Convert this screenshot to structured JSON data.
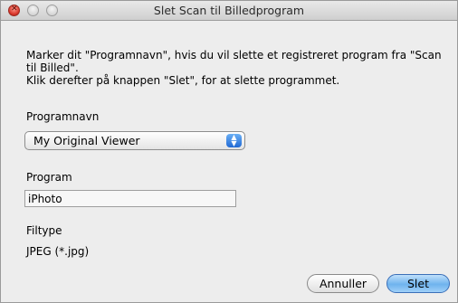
{
  "window": {
    "title": "Slet Scan til Billedprogram"
  },
  "dialog": {
    "instruction_line1": "Marker dit \"Programnavn\", hvis du vil slette et registreret program fra \"Scan",
    "instruction_line2": "til Billed\".",
    "instruction_line3": "Klik derefter på knappen \"Slet\", for at slette programmet.",
    "program_name_label": "Programnavn",
    "program_name_value": "My Original Viewer",
    "program_label": "Program",
    "program_value": "iPhoto",
    "filetype_label": "Filtype",
    "filetype_value": "JPEG (*.jpg)"
  },
  "buttons": {
    "cancel_label": "Annuller",
    "delete_label": "Slet"
  },
  "icons": {
    "close": "close-icon",
    "minimize": "minimize-icon",
    "zoom": "zoom-icon",
    "popup_arrows": "updown-chevron-icon"
  }
}
